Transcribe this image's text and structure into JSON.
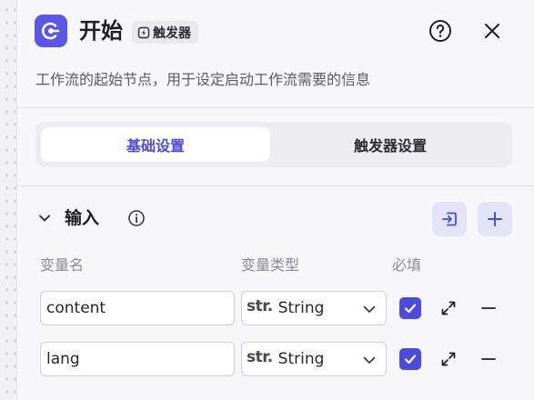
{
  "header": {
    "title": "开始",
    "badge_label": "触发器"
  },
  "description": "工作流的起始节点，用于设定启动工作流需要的信息",
  "tabs": [
    {
      "label": "基础设置",
      "active": true
    },
    {
      "label": "触发器设置",
      "active": false
    }
  ],
  "input_section": {
    "title": "输入",
    "columns": {
      "name": "变量名",
      "type": "变量类型",
      "required": "必填"
    },
    "rows": [
      {
        "name": "content",
        "type_prefix": "str.",
        "type": "String",
        "required": true
      },
      {
        "name": "lang",
        "type_prefix": "str.",
        "type": "String",
        "required": true
      }
    ]
  },
  "colors": {
    "accent": "#4d4ae0",
    "icon_bg": "#5b57e6",
    "button_bg": "#e3e3fa"
  },
  "icons": [
    "start-node-icon",
    "trigger-icon",
    "help-icon",
    "close-icon",
    "chevron-down-icon",
    "info-icon",
    "import-icon",
    "plus-icon",
    "expand-icon",
    "minus-icon"
  ]
}
